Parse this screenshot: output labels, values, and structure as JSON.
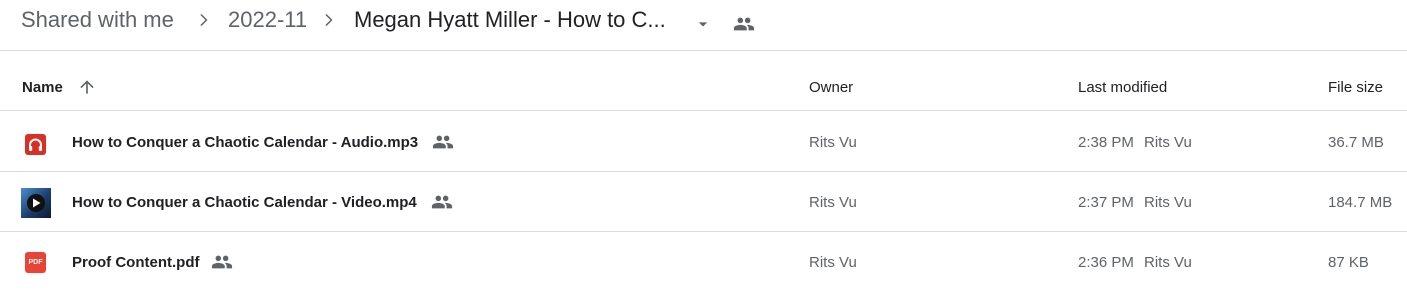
{
  "breadcrumb": {
    "items": [
      {
        "label": "Shared with me"
      },
      {
        "label": "2022-11"
      },
      {
        "label": "Megan Hyatt Miller - How to C..."
      }
    ]
  },
  "table": {
    "headers": {
      "name": "Name",
      "owner": "Owner",
      "last_modified": "Last modified",
      "file_size": "File size"
    },
    "rows": [
      {
        "name": "How to Conquer a Chaotic Calendar - Audio.mp3",
        "type_icon": "audio-file-icon",
        "owner": "Rits Vu",
        "modified_time": "2:38 PM",
        "modified_by": "Rits Vu",
        "size": "36.7 MB"
      },
      {
        "name": "How to Conquer a Chaotic Calendar - Video.mp4",
        "type_icon": "video-file-icon",
        "owner": "Rits Vu",
        "modified_time": "2:37 PM",
        "modified_by": "Rits Vu",
        "size": "184.7 MB"
      },
      {
        "name": "Proof Content.pdf",
        "type_icon": "pdf-file-icon",
        "owner": "Rits Vu",
        "modified_time": "2:36 PM",
        "modified_by": "Rits Vu",
        "size": "87 KB"
      }
    ]
  },
  "colors": {
    "audio_icon": "#d93025",
    "pdf_icon": "#ea4335",
    "divider": "#dadce0",
    "text_primary": "#202124",
    "text_secondary": "#5f6368"
  },
  "pdf_badge": "PDF"
}
